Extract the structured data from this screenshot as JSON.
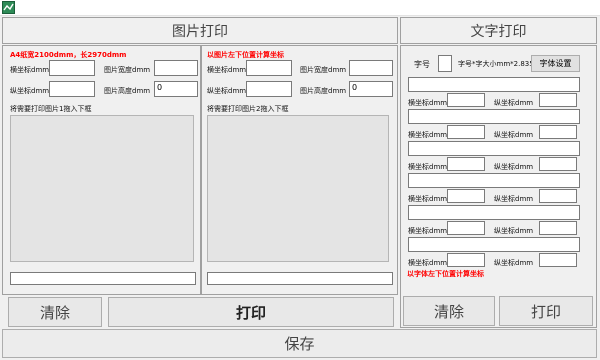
{
  "header": {
    "image_print_title": "图片打印",
    "text_print_title": "文字打印"
  },
  "left_panel": {
    "note": "A4纸宽2100dmm，长2970dmm",
    "x_label": "横坐标dmm",
    "x_value": "",
    "width_label": "图片宽度dmm",
    "width_value": "",
    "y_label": "纵坐标dmm",
    "y_value": "",
    "height_label": "图片高度dmm",
    "height_value": "0",
    "drop_label": "将需要打印图片1拖入下框",
    "path_value": ""
  },
  "middle_panel": {
    "note": "以图片左下位置计算坐标",
    "x_label": "横坐标dmm",
    "x_value": "",
    "width_label": "图片宽度dmm",
    "width_value": "",
    "y_label": "纵坐标dmm",
    "y_value": "",
    "height_label": "图片高度dmm",
    "height_value": "0",
    "drop_label": "将需要打印图片2拖入下框",
    "path_value": ""
  },
  "right_panel": {
    "font_size_label": "字号",
    "font_size_value": "",
    "font_formula": "字号*字大小mm*2.835",
    "font_settings_button": "字体设置",
    "x_label": "横坐标dmm",
    "y_label": "纵坐标dmm",
    "rows": [
      {
        "text": "",
        "x": "",
        "y": ""
      },
      {
        "text": "",
        "x": "",
        "y": ""
      },
      {
        "text": "",
        "x": "",
        "y": ""
      },
      {
        "text": "",
        "x": "",
        "y": ""
      },
      {
        "text": "",
        "x": "",
        "y": ""
      },
      {
        "text": "",
        "x": "",
        "y": ""
      }
    ],
    "note": "以字体左下位置计算坐标"
  },
  "buttons": {
    "clear_image": "清除",
    "print_image": "打印",
    "clear_text": "清除",
    "print_text": "打印",
    "save": "保存"
  }
}
